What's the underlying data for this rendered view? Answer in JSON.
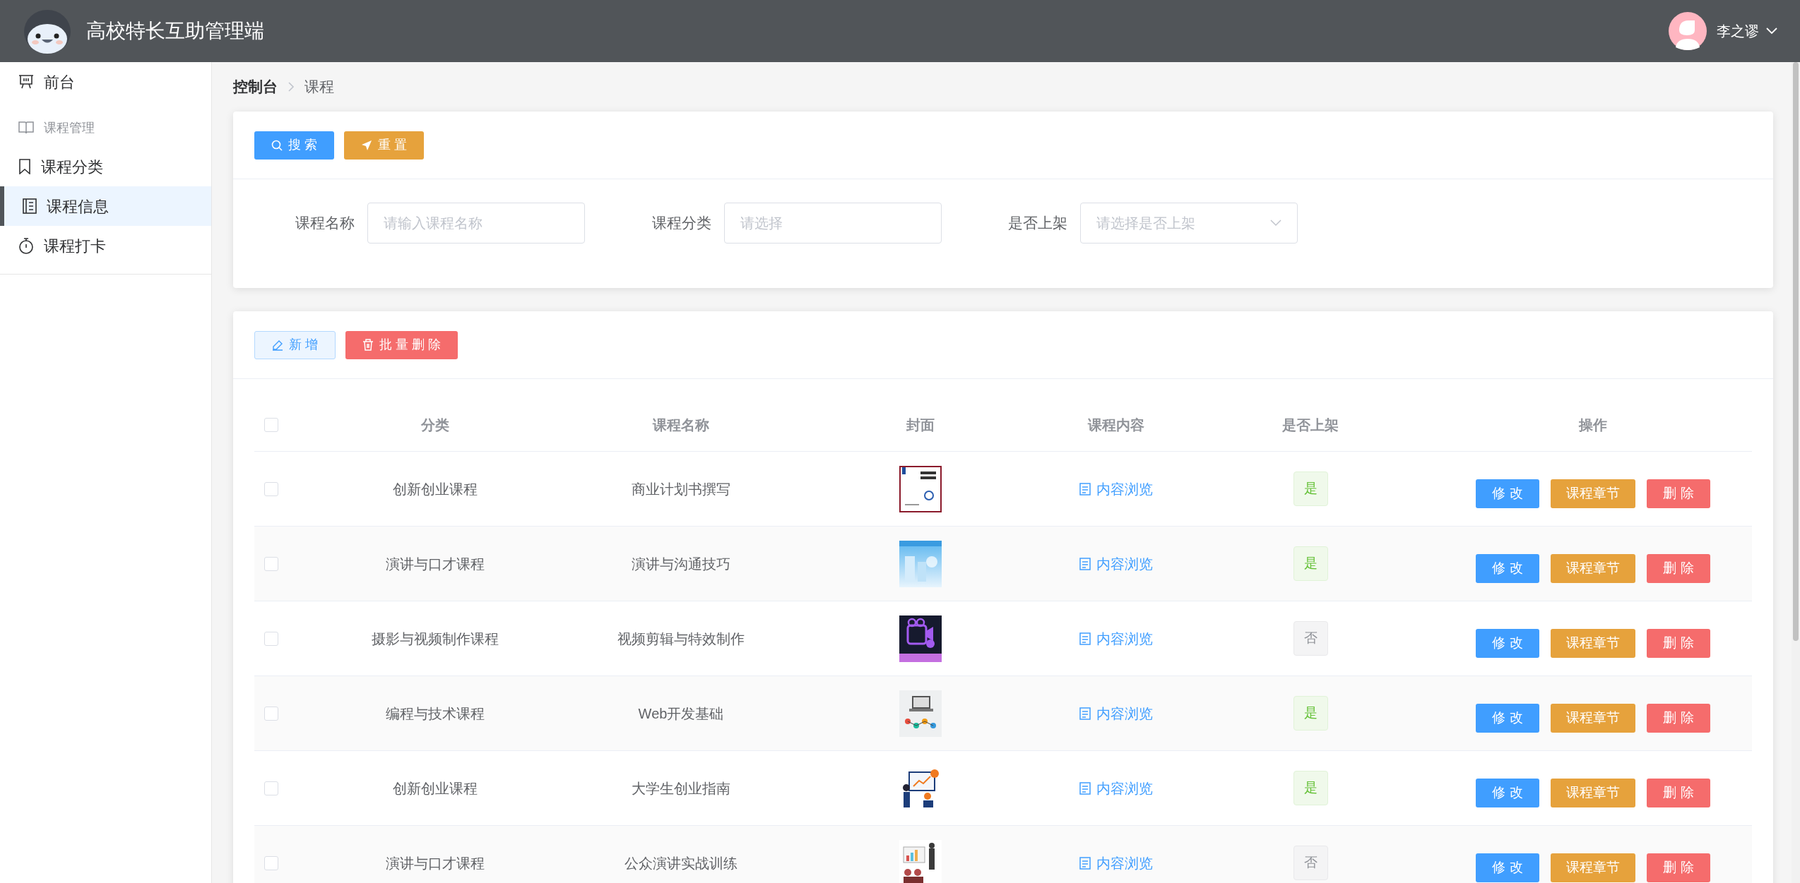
{
  "header": {
    "title": "高校特长互助管理端",
    "user": "李之谬"
  },
  "sidebar": {
    "items": [
      {
        "kind": "item",
        "label": "前台",
        "selected": false
      },
      {
        "kind": "group",
        "label": "课程管理"
      },
      {
        "kind": "item",
        "label": "课程分类",
        "selected": false
      },
      {
        "kind": "item",
        "label": "课程信息",
        "selected": true
      },
      {
        "kind": "item",
        "label": "课程打卡",
        "selected": false
      }
    ]
  },
  "breadcrumb": [
    "控制台",
    "课程"
  ],
  "search_panel": {
    "buttons": [
      {
        "kind": "search",
        "label": "搜 索"
      },
      {
        "kind": "reset",
        "label": "重 置"
      }
    ],
    "filters": [
      {
        "kind": "input",
        "label": "课程名称",
        "placeholder": "请输入课程名称"
      },
      {
        "kind": "input",
        "label": "课程分类",
        "placeholder": "请选择"
      },
      {
        "kind": "select",
        "label": "是否上架",
        "placeholder": "请选择是否上架"
      }
    ]
  },
  "toolbar": {
    "buttons": [
      {
        "kind": "add",
        "label": "新 增"
      },
      {
        "kind": "batch_delete",
        "label": "批 量 删 除"
      }
    ]
  },
  "table": {
    "all_checked": false,
    "columns": [
      "分类",
      "课程名称",
      "封面",
      "课程内容",
      "是否上架",
      "操作"
    ],
    "rows": [
      {
        "checked": false,
        "category": "创新创业课程",
        "name": "商业计划书撰写",
        "content_link": "内容浏览",
        "listed": true,
        "listed_label": "是",
        "actions": [
          {
            "kind": "edit",
            "label": "修 改"
          },
          {
            "kind": "chapters",
            "label": "课程章节"
          },
          {
            "kind": "delete",
            "label": "删 除"
          }
        ]
      },
      {
        "checked": false,
        "category": "演讲与口才课程",
        "name": "演讲与沟通技巧",
        "content_link": "内容浏览",
        "listed": true,
        "listed_label": "是",
        "actions": [
          {
            "kind": "edit",
            "label": "修 改"
          },
          {
            "kind": "chapters",
            "label": "课程章节"
          },
          {
            "kind": "delete",
            "label": "删 除"
          }
        ]
      },
      {
        "checked": false,
        "category": "摄影与视频制作课程",
        "name": "视频剪辑与特效制作",
        "content_link": "内容浏览",
        "listed": false,
        "listed_label": "否",
        "actions": [
          {
            "kind": "edit",
            "label": "修 改"
          },
          {
            "kind": "chapters",
            "label": "课程章节"
          },
          {
            "kind": "delete",
            "label": "删 除"
          }
        ]
      },
      {
        "checked": false,
        "category": "编程与技术课程",
        "name": "Web开发基础",
        "content_link": "内容浏览",
        "listed": true,
        "listed_label": "是",
        "actions": [
          {
            "kind": "edit",
            "label": "修 改"
          },
          {
            "kind": "chapters",
            "label": "课程章节"
          },
          {
            "kind": "delete",
            "label": "删 除"
          }
        ]
      },
      {
        "checked": false,
        "category": "创新创业课程",
        "name": "大学生创业指南",
        "content_link": "内容浏览",
        "listed": true,
        "listed_label": "是",
        "actions": [
          {
            "kind": "edit",
            "label": "修 改"
          },
          {
            "kind": "chapters",
            "label": "课程章节"
          },
          {
            "kind": "delete",
            "label": "删 除"
          }
        ]
      },
      {
        "checked": false,
        "category": "演讲与口才课程",
        "name": "公众演讲实战训练",
        "content_link": "内容浏览",
        "listed": false,
        "listed_label": "否",
        "actions": [
          {
            "kind": "edit",
            "label": "修 改"
          },
          {
            "kind": "chapters",
            "label": "课程章节"
          },
          {
            "kind": "delete",
            "label": "删 除"
          }
        ]
      }
    ]
  }
}
